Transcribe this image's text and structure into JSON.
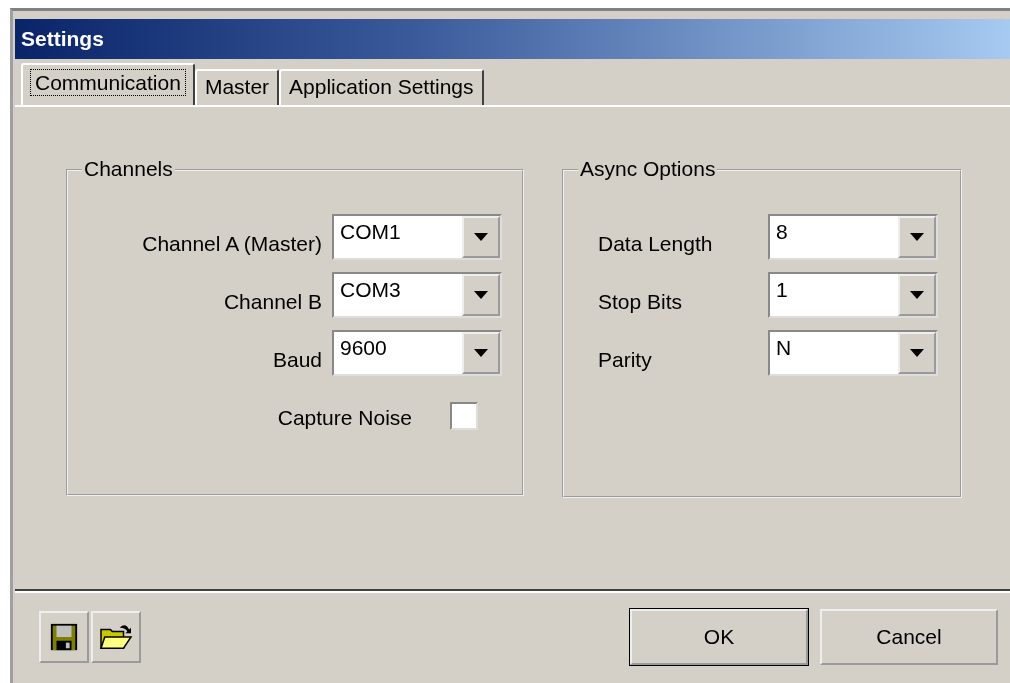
{
  "window": {
    "title": "Settings"
  },
  "tabs": [
    {
      "label": "Communication",
      "selected": true
    },
    {
      "label": "Master",
      "selected": false
    },
    {
      "label": "Application Settings",
      "selected": false
    }
  ],
  "groups": [
    {
      "title": "Channels",
      "fields": [
        {
          "kind": "dropdown",
          "label": "Channel A (Master)",
          "value": "COM1"
        },
        {
          "kind": "dropdown",
          "label": "Channel B",
          "value": "COM3"
        },
        {
          "kind": "dropdown",
          "label": "Baud",
          "value": "9600"
        },
        {
          "kind": "checkbox",
          "label": "Capture Noise",
          "checked": false
        }
      ]
    },
    {
      "title": "Async Options",
      "fields": [
        {
          "kind": "dropdown",
          "label": "Data Length",
          "value": "8"
        },
        {
          "kind": "dropdown",
          "label": "Stop Bits",
          "value": "1"
        },
        {
          "kind": "dropdown",
          "label": "Parity",
          "value": "N"
        }
      ]
    }
  ],
  "buttons": [
    "OK",
    "Cancel"
  ]
}
